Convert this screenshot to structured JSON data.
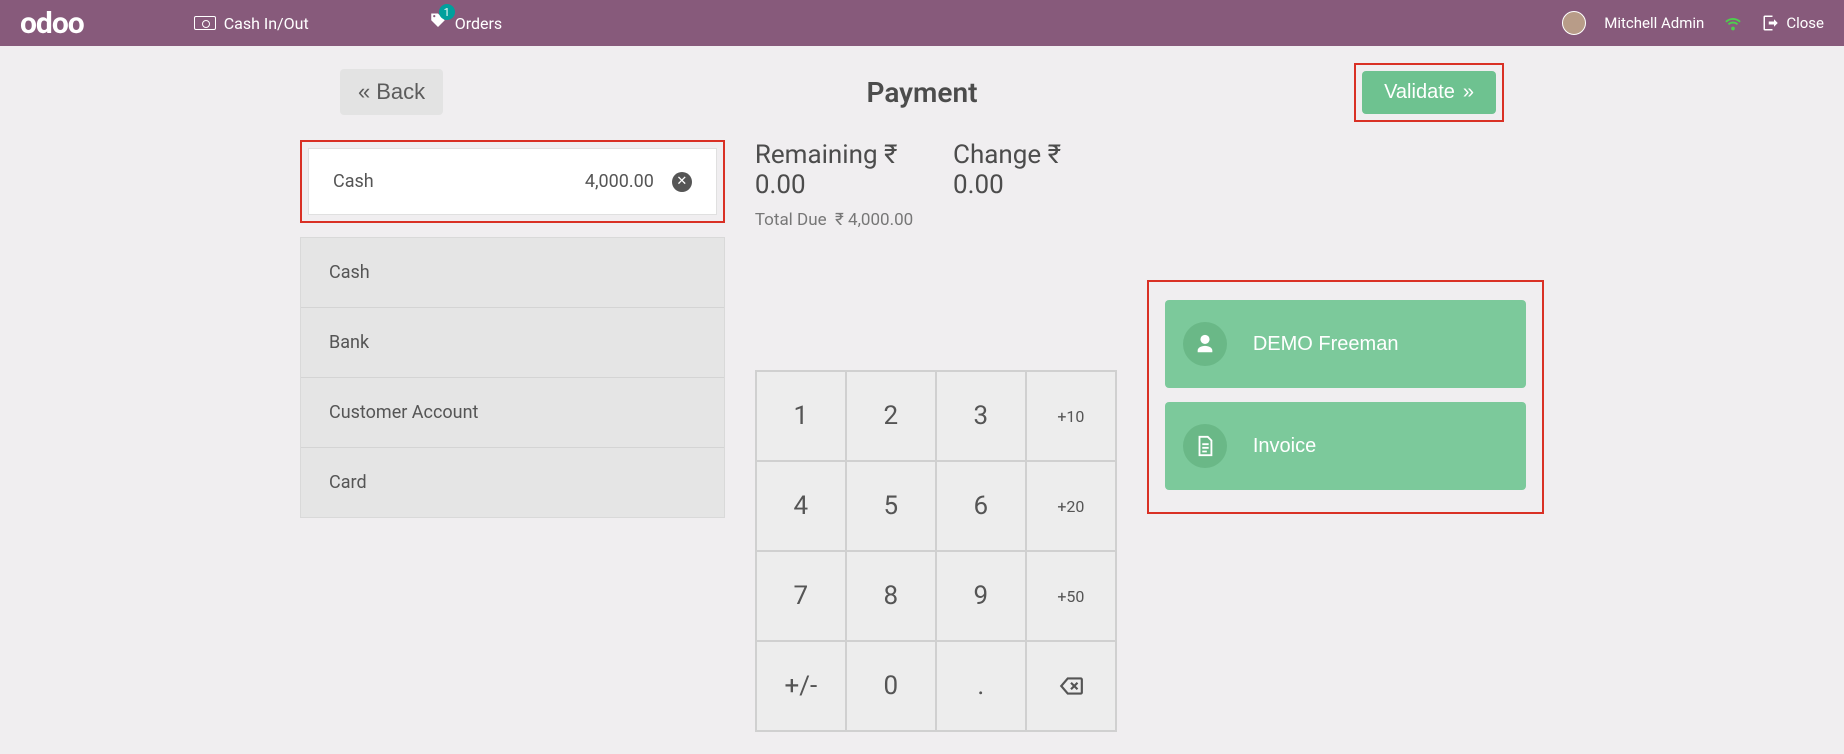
{
  "topbar": {
    "logo": "odoo",
    "cash_in_out": "Cash In/Out",
    "orders": "Orders",
    "orders_badge": "1",
    "user": "Mitchell Admin",
    "close": "Close"
  },
  "header": {
    "back": "Back",
    "title": "Payment",
    "validate": "Validate"
  },
  "selected_payment": {
    "method": "Cash",
    "amount": "4,000.00"
  },
  "payment_methods": [
    "Cash",
    "Bank",
    "Customer Account",
    "Card"
  ],
  "totals": {
    "remaining_label": "Remaining",
    "remaining_value": "₹ 0.00",
    "change_label": "Change",
    "change_value": "₹ 0.00",
    "due_label": "Total Due",
    "due_value": "₹ 4,000.00"
  },
  "numpad": {
    "r0": [
      "1",
      "2",
      "3",
      "+10"
    ],
    "r1": [
      "4",
      "5",
      "6",
      "+20"
    ],
    "r2": [
      "7",
      "8",
      "9",
      "+50"
    ],
    "r3": [
      "+/-",
      "0",
      ".",
      "⌫"
    ]
  },
  "actions": {
    "customer": "DEMO Freeman",
    "invoice": "Invoice"
  }
}
